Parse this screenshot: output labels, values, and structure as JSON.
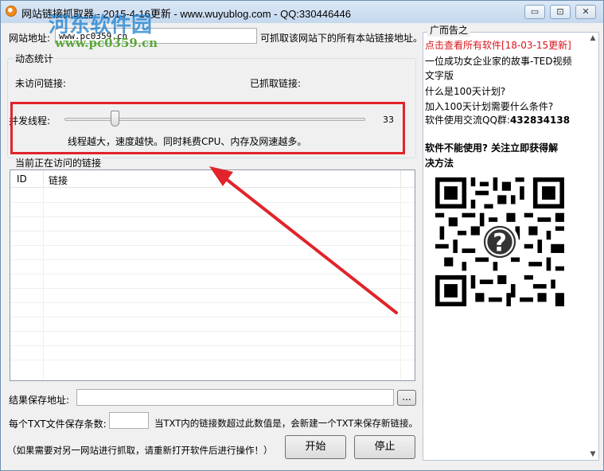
{
  "window": {
    "title": "网站链接抓取器 - 2015-4-16更新 - www.wuyublog.com - QQ:330446446",
    "min_glyph": "▭",
    "max_glyph": "⊡",
    "close_glyph": "✕"
  },
  "watermark": {
    "name": "河东软件园",
    "url": "www.pc0359.cn"
  },
  "site": {
    "label": "网站地址:",
    "value": "www.pc0359.cn",
    "hint": "可抓取该网站下的所有本站链接地址。"
  },
  "stats": {
    "group_title": "动态统计",
    "unvisited_label": "未访问链接:",
    "fetched_label": "已抓取链接:"
  },
  "threads": {
    "label": "并发线程:",
    "value": "33",
    "level": 0.15,
    "note": "线程越大，速度越快。同时耗费CPU、内存及网速越多。"
  },
  "current": {
    "group_title": "当前正在访问的链接",
    "columns": [
      "ID",
      "链接"
    ]
  },
  "save": {
    "label": "结果保存地址:",
    "value": "",
    "browse_label": "..."
  },
  "per_file": {
    "label": "每个TXT文件保存条数:",
    "value": "",
    "hint": "当TXT内的链接数超过此数值是，会新建一个TXT来保存新链接。"
  },
  "footer_note": "（如果需要对另一网站进行抓取，请重新打开软件后进行操作！）",
  "buttons": {
    "start": "开始",
    "stop": "停止"
  },
  "ad": {
    "title": "广而告之",
    "lines": [
      "点击查看所有软件[18-03-15更新]",
      "一位成功女企业家的故事-TED视频",
      "文字版",
      "什么是100天计划?",
      "加入100天计划需要什么条件?",
      "软件使用交流QQ群:",
      "软件不能使用? 关注立即获得解",
      "决方法"
    ],
    "qq_group": "432834138",
    "scroll_up": "▲",
    "scroll_down": "▼",
    "qr_center_glyph": "?"
  },
  "colors": {
    "annotation_red": "#e0242a",
    "ad_link_red": "#d8141b"
  }
}
